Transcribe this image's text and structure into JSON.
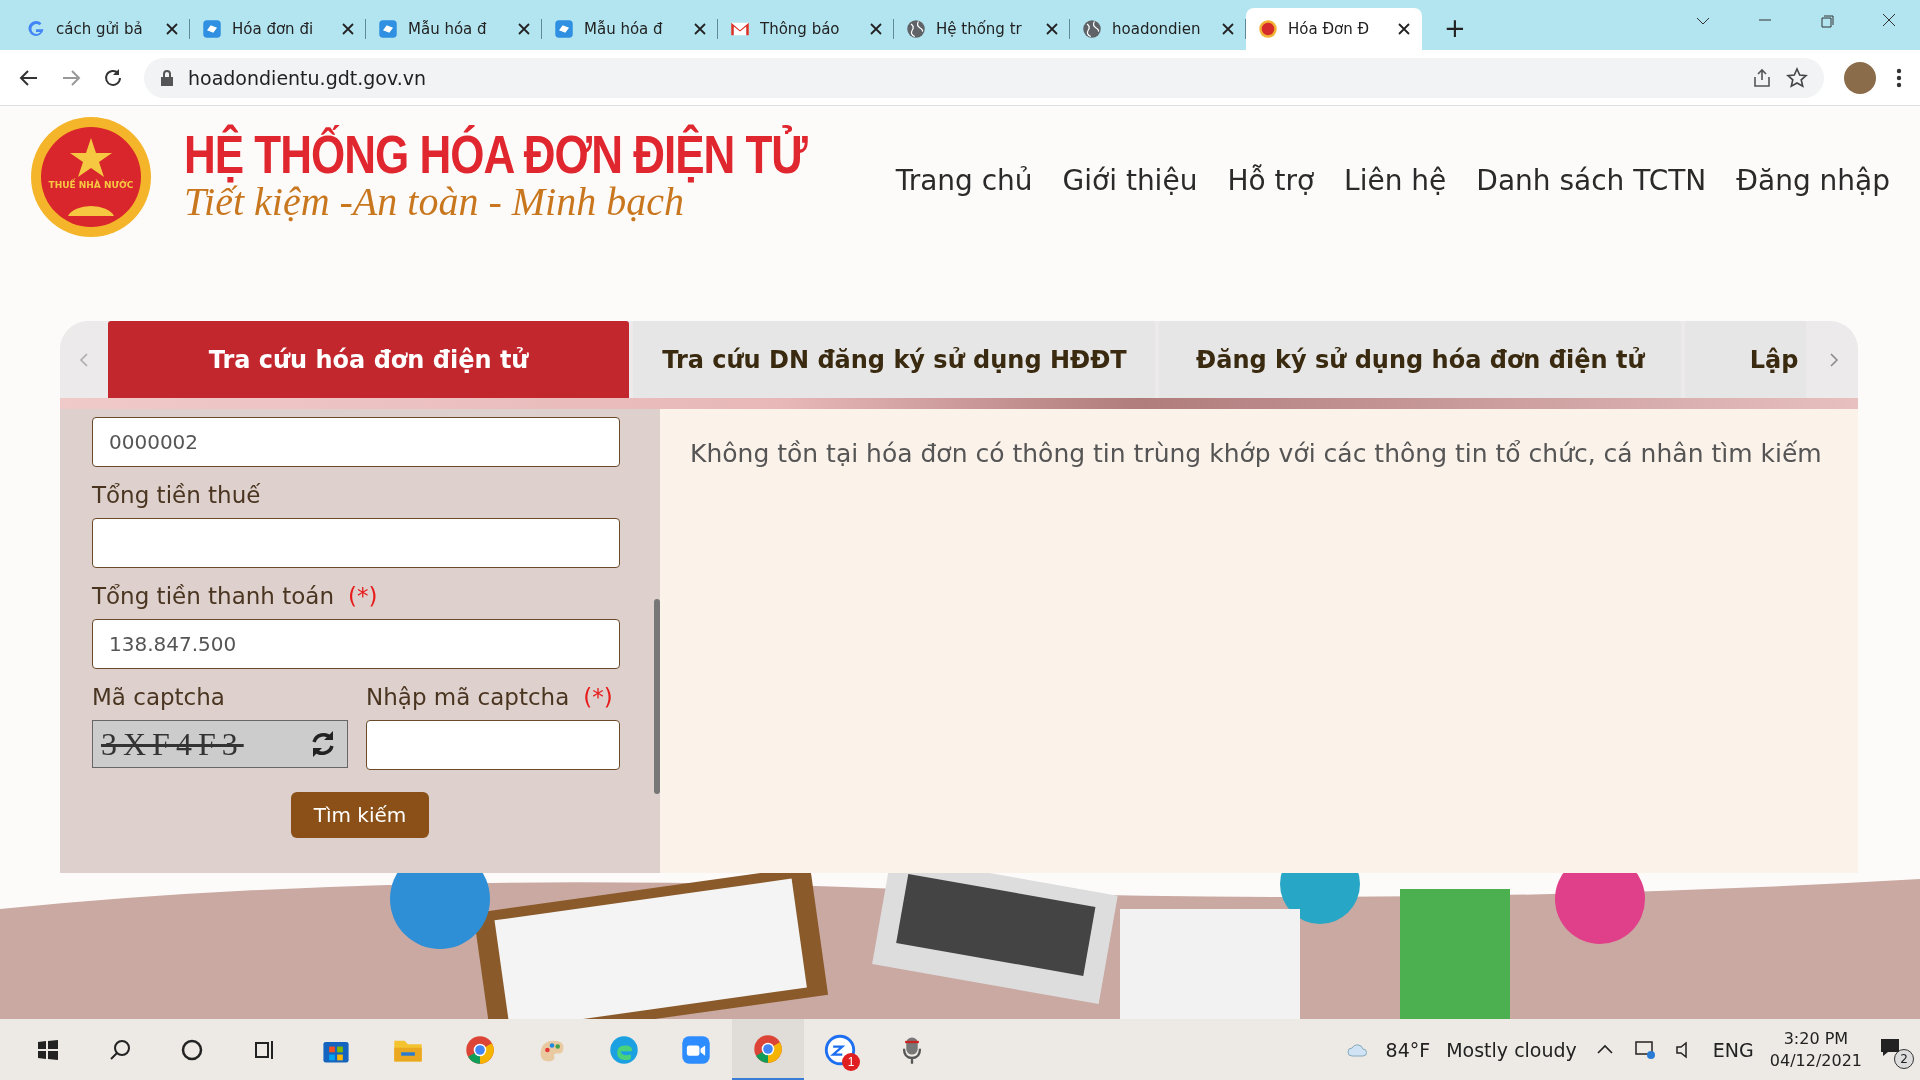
{
  "browser": {
    "tabs": [
      {
        "title": "cách gửi bả",
        "kind": "google",
        "selected": false
      },
      {
        "title": "Hóa đơn đi",
        "kind": "doc",
        "selected": false
      },
      {
        "title": "Mẫu hóa đ",
        "kind": "doc",
        "selected": false
      },
      {
        "title": "Mẫu hóa đ",
        "kind": "doc",
        "selected": false
      },
      {
        "title": "Thông báo",
        "kind": "mail",
        "selected": false
      },
      {
        "title": "Hệ thống tr",
        "kind": "globe",
        "selected": false
      },
      {
        "title": "hoadondien",
        "kind": "globe",
        "selected": false
      },
      {
        "title": "Hóa Đơn Đ",
        "kind": "emblem",
        "selected": true
      }
    ],
    "new_tab": "+",
    "url": "hoadondientu.gdt.gov.vn"
  },
  "header": {
    "emblem_text": "THUẾ NHÀ NƯỚC",
    "title": "HỆ THỐNG HÓA ĐƠN ĐIỆN TỬ",
    "slogan": "Tiết kiệm -An toàn - Minh bạch",
    "nav": [
      "Trang chủ",
      "Giới thiệu",
      "Hỗ trợ",
      "Liên hệ",
      "Danh sách TCTN",
      "Đăng nhập"
    ]
  },
  "tabs": [
    {
      "label": "Tra cứu hóa đơn điện tử",
      "selected": true
    },
    {
      "label": "Tra cứu DN đăng ký sử dụng HĐĐT",
      "selected": false
    },
    {
      "label": "Đăng ký sử dụng hóa đơn điện tử",
      "selected": false
    },
    {
      "label": "Lập",
      "selected": false
    }
  ],
  "form": {
    "fields": [
      {
        "value": "0000002"
      },
      {
        "label": "Tổng tiền thuế"
      },
      {
        "label": "Tổng tiền thanh toán",
        "required_mark": "(*)",
        "value": "138.847.500"
      }
    ],
    "captcha": {
      "label": "Mã captcha",
      "code": "3XF4F3",
      "input_label": "Nhập mã captcha",
      "required_mark": "(*)"
    },
    "submit": "Tìm kiếm"
  },
  "result": {
    "message": "Không tồn tại hóa đơn có thông tin trùng khớp với các thông tin tổ chức, cá nhân tìm kiếm"
  },
  "taskbar": {
    "apps": [
      {
        "kind": "store",
        "active": false
      },
      {
        "kind": "folder",
        "active": false
      },
      {
        "kind": "chrome",
        "active": false
      },
      {
        "kind": "paint",
        "active": false
      },
      {
        "kind": "edge",
        "active": false
      },
      {
        "kind": "zoom",
        "active": false
      },
      {
        "kind": "chrome",
        "active": true
      },
      {
        "kind": "zalo",
        "active": false,
        "badge": "1"
      },
      {
        "kind": "mic",
        "active": false
      }
    ],
    "weather": {
      "temp": "84°F",
      "condition": "Mostly cloudy"
    },
    "language": "ENG",
    "time": "3:20 PM",
    "date": "04/12/2021",
    "notifications": "2"
  }
}
